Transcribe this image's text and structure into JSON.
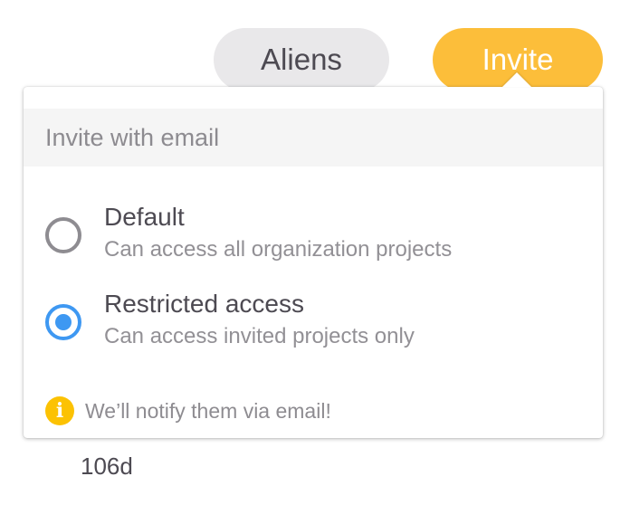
{
  "header": {
    "org_button_label": "Aliens",
    "invite_button_label": "Invite"
  },
  "invite_popover": {
    "title": "Invite with email",
    "options": [
      {
        "label": "Default",
        "description": "Can access all organization projects",
        "selected": false
      },
      {
        "label": "Restricted access",
        "description": "Can access invited projects only",
        "selected": true
      }
    ],
    "notice": "We’ll notify them via email!",
    "notice_icon": "info-icon"
  },
  "background": {
    "partial_text": "106d"
  },
  "colors": {
    "invite_accent": "#fcbe3a",
    "radio_selected": "#3e98f2",
    "info_icon": "#fcc203"
  }
}
